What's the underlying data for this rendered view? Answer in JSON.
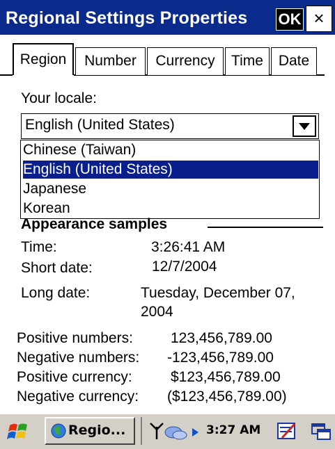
{
  "window": {
    "title": "Regional Settings Properties",
    "ok_label": "OK",
    "close_label": "×"
  },
  "tabs": [
    {
      "label": "Region",
      "active": true
    },
    {
      "label": "Number",
      "active": false
    },
    {
      "label": "Currency",
      "active": false
    },
    {
      "label": "Time",
      "active": false
    },
    {
      "label": "Date",
      "active": false
    }
  ],
  "locale": {
    "label": "Your locale:",
    "value": "English (United States)",
    "options": [
      "Chinese (Taiwan)",
      "English (United States)",
      "Japanese",
      "Korean"
    ],
    "selected_index": 1
  },
  "appearance": {
    "title": "Appearance samples",
    "time_label": "Time:",
    "time_value": "3:26:41 AM",
    "short_date_label": "Short date:",
    "short_date_value": "12/7/2004",
    "long_date_label": "Long date:",
    "long_date_value_line1": "Tuesday, December 07,",
    "long_date_value_line2": "2004",
    "positive_numbers_label": "Positive numbers:",
    "positive_numbers_value": "123,456,789.00",
    "negative_numbers_label": "Negative numbers:",
    "negative_numbers_value": "-123,456,789.00",
    "positive_currency_label": "Positive currency:",
    "positive_currency_value": "$123,456,789.00",
    "negative_currency_label": "Negative currency:",
    "negative_currency_value": "($123,456,789.00)"
  },
  "taskbar": {
    "task_label": "Regio...",
    "clock": "3:27 AM",
    "icons": [
      "start-flag-icon",
      "app-globe-icon",
      "antenna-icon",
      "network-icon",
      "arrow-icon",
      "input-panel-icon",
      "windows-icon"
    ]
  },
  "colors": {
    "titlebar": "#0a2a8c",
    "selection": "#0a1f8c",
    "taskbar": "#d4d0c8"
  }
}
